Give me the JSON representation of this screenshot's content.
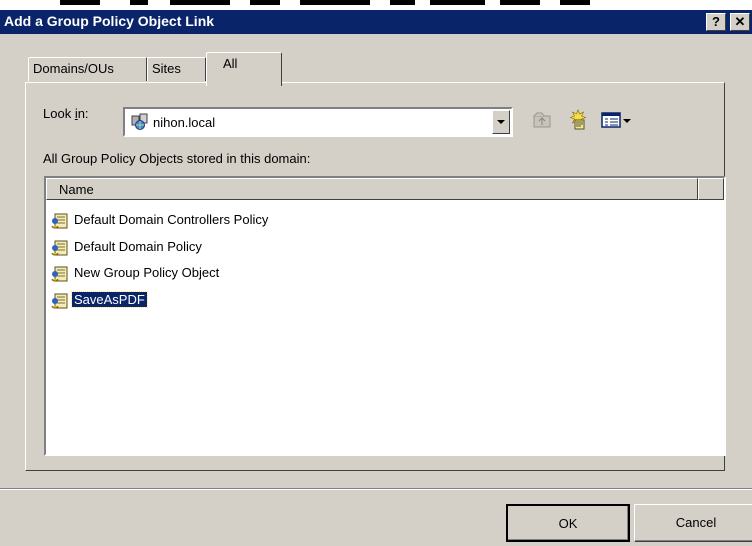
{
  "window": {
    "title": "Add a Group Policy Object Link",
    "help_button": "?",
    "close_button": "✕"
  },
  "tabs": [
    {
      "label": "Domains/OUs",
      "active": false
    },
    {
      "label": "Sites",
      "active": false
    },
    {
      "label": "All",
      "active": true
    }
  ],
  "look_in": {
    "label_prefix": "Look ",
    "label_accel": "i",
    "label_suffix": "n:",
    "value": "nihon.local",
    "icon": "domain-icon"
  },
  "toolbar": {
    "icons": [
      "up-folder-icon",
      "new-gpo-icon",
      "view-menu-icon",
      "dropdown-arrow-icon"
    ]
  },
  "list": {
    "caption": "All Group Policy Objects stored in this domain:",
    "columns": [
      "Name"
    ],
    "items": [
      {
        "name": "Default Domain Controllers Policy",
        "icon": "gpo-icon",
        "selected": false
      },
      {
        "name": "Default Domain Policy",
        "icon": "gpo-icon",
        "selected": false
      },
      {
        "name": "New Group Policy Object",
        "icon": "gpo-icon",
        "selected": false
      },
      {
        "name": "SaveAsPDF",
        "icon": "gpo-icon",
        "selected": true
      }
    ]
  },
  "buttons": {
    "ok": "OK",
    "cancel": "Cancel"
  },
  "colors": {
    "titlebar": "#0a246a",
    "dialog_face": "#d4d0c8",
    "selection": "#0a246a"
  }
}
